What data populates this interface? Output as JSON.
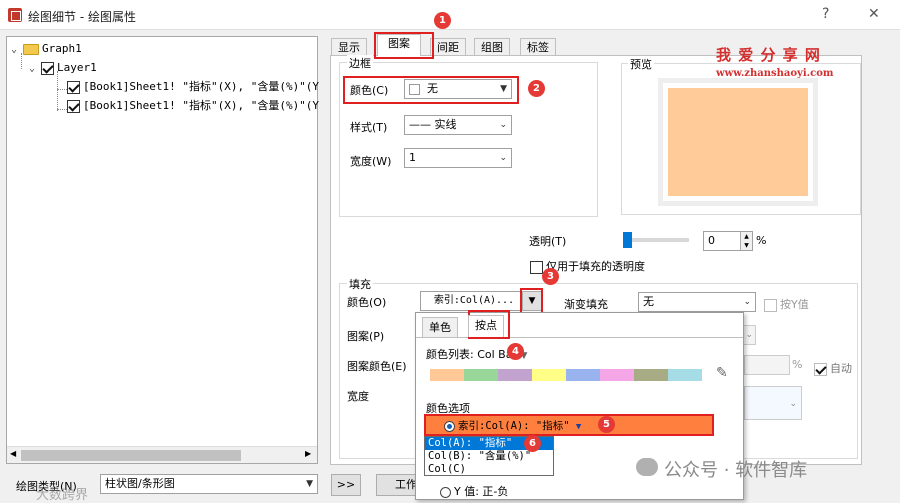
{
  "window": {
    "title": "绘图细节 - 绘图属性",
    "help_label": "?",
    "close_label": "✕"
  },
  "tree": {
    "root": "Graph1",
    "layer": "Layer1",
    "plots": [
      "[Book1]Sheet1! \"指标\"(X), \"含量(%)\"(Y",
      "[Book1]Sheet1! \"指标\"(X), \"含量(%)\"(Y"
    ]
  },
  "bottom": {
    "plot_type_label": "绘图类型(N)",
    "plot_type_value": "柱状图/条形图",
    "expand_button": ">>",
    "workbook_button": "工作"
  },
  "tabs": [
    "显示",
    "图案",
    "间距",
    "组图",
    "标签"
  ],
  "border": {
    "group_label": "边框",
    "color_label": "颜色(C)",
    "color_value": "无",
    "style_label": "样式(T)",
    "style_value": "—— 实线",
    "width_label": "宽度(W)",
    "width_value": "1"
  },
  "preview": {
    "group_label": "预览",
    "fill_color": "#FFCC99"
  },
  "transparency": {
    "label": "透明(T)",
    "value": "0",
    "unit": "%",
    "level": 0,
    "fill_only_label": "仅用于填充的透明度"
  },
  "fill": {
    "group_label": "填充",
    "color_label": "颜色(O)",
    "color_value": "索引:Col(A)...",
    "gradient_label": "渐变填充",
    "gradient_value": "无",
    "by_y_label": "按Y值",
    "pattern_label": "图案(P)",
    "pattern_color_label": "图案颜色(E)",
    "width_label": "宽度",
    "percent_unit": "%",
    "auto_label": "自动"
  },
  "popup": {
    "tab_single": "单色",
    "tab_by_point": "按点",
    "color_list_label": "颜色列表: Col",
    "color_list_value": "Bar",
    "swatches": [
      "#FFC896",
      "#99D69A",
      "#C2A3D0",
      "#FFFF88",
      "#99B3EE",
      "#F5A6E6",
      "#A8AC84",
      "#A5DCE6"
    ],
    "options_label": "颜色选项",
    "index_option": "索引:Col(A): \"指标\"",
    "dropdown_items": [
      "Col(A): \"指标\"",
      "Col(B): \"含量(%)\"",
      "Col(C)"
    ],
    "y_value_option": "Y 值: 正-负"
  },
  "badges": [
    "1",
    "2",
    "3",
    "4",
    "5",
    "6"
  ],
  "watermarks": {
    "site_cn": "我 爱 分 享 网",
    "site_url": "www.zhanshaoyi.com",
    "wechat": "公众号 · 软件智库",
    "corner": "大数跨界"
  },
  "colors": {
    "annotation_red": "#E53935",
    "highlight_orange": "#FF7F3F",
    "selection_blue": "#0078D7",
    "watermark_red": "#D32F2F"
  }
}
